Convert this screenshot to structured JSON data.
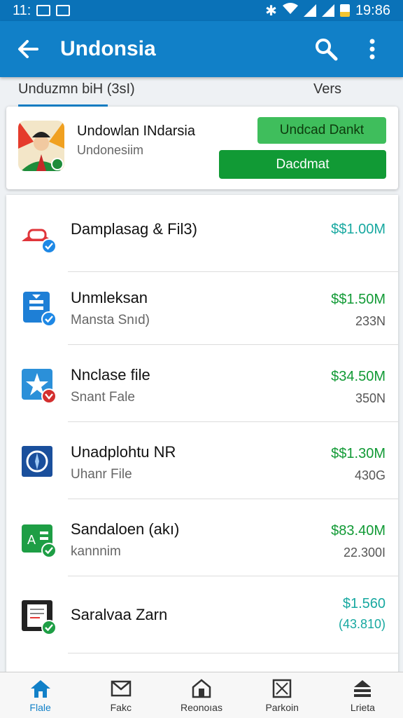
{
  "status_bar": {
    "time_left": "11:",
    "time_right": "19:86"
  },
  "app_bar": {
    "title": "Undonsia",
    "back_icon": "arrow-left-icon",
    "search_icon": "search-icon",
    "more_icon": "more-vertical-icon"
  },
  "tabs": [
    {
      "label": "Unduzmn biH  (3sI)"
    },
    {
      "label": "Vers"
    }
  ],
  "hero": {
    "title": "Undowlan INdarsia",
    "subtitle": "Undonesiim",
    "button_primary": "Undcad Dankt",
    "button_secondary": "Dacdmat"
  },
  "list": [
    {
      "name": "Damplasag & Fil3)",
      "sub": "",
      "price": "$$1.00M",
      "size": "",
      "icon": "hat-icon",
      "price_color": "#17a8a0"
    },
    {
      "name": "Unmleksan",
      "sub": "Mansta Snıd)",
      "price": "$$1.50M",
      "size": "233N",
      "icon": "document-icon",
      "price_color": "#119a35"
    },
    {
      "name": "Nnclase file",
      "sub": "Snant Fale",
      "price": "$34.50M",
      "size": "350N",
      "icon": "star-icon",
      "price_color": "#119a35"
    },
    {
      "name": "Unadplohtu NR",
      "sub": "Uhanr File",
      "price": "$$1.30M",
      "size": "430G",
      "icon": "compass-icon",
      "price_color": "#119a35"
    },
    {
      "name": "Sandaloen (akı)",
      "sub": "kannnim",
      "price": "$83.40M",
      "size": "22.300I",
      "icon": "spreadsheet-icon",
      "price_color": "#119a35"
    },
    {
      "name": "Saralvaa Zarn",
      "sub": "",
      "price": "$1.560",
      "size": "(43.810)",
      "icon": "notepad-icon",
      "price_color": "#17a8a0"
    }
  ],
  "bottom_nav": [
    {
      "label": "Flale",
      "icon": "home-icon"
    },
    {
      "label": "Fakc",
      "icon": "mail-icon"
    },
    {
      "label": "Reonoıas",
      "icon": "building-icon"
    },
    {
      "label": "Parkoin",
      "icon": "image-box-icon"
    },
    {
      "label": "Lrieta",
      "icon": "inbox-icon"
    }
  ],
  "colors": {
    "app_bar": "#1180c8",
    "status_bar": "#0a72b8",
    "green": "#119a35",
    "teal": "#17a8a0"
  }
}
